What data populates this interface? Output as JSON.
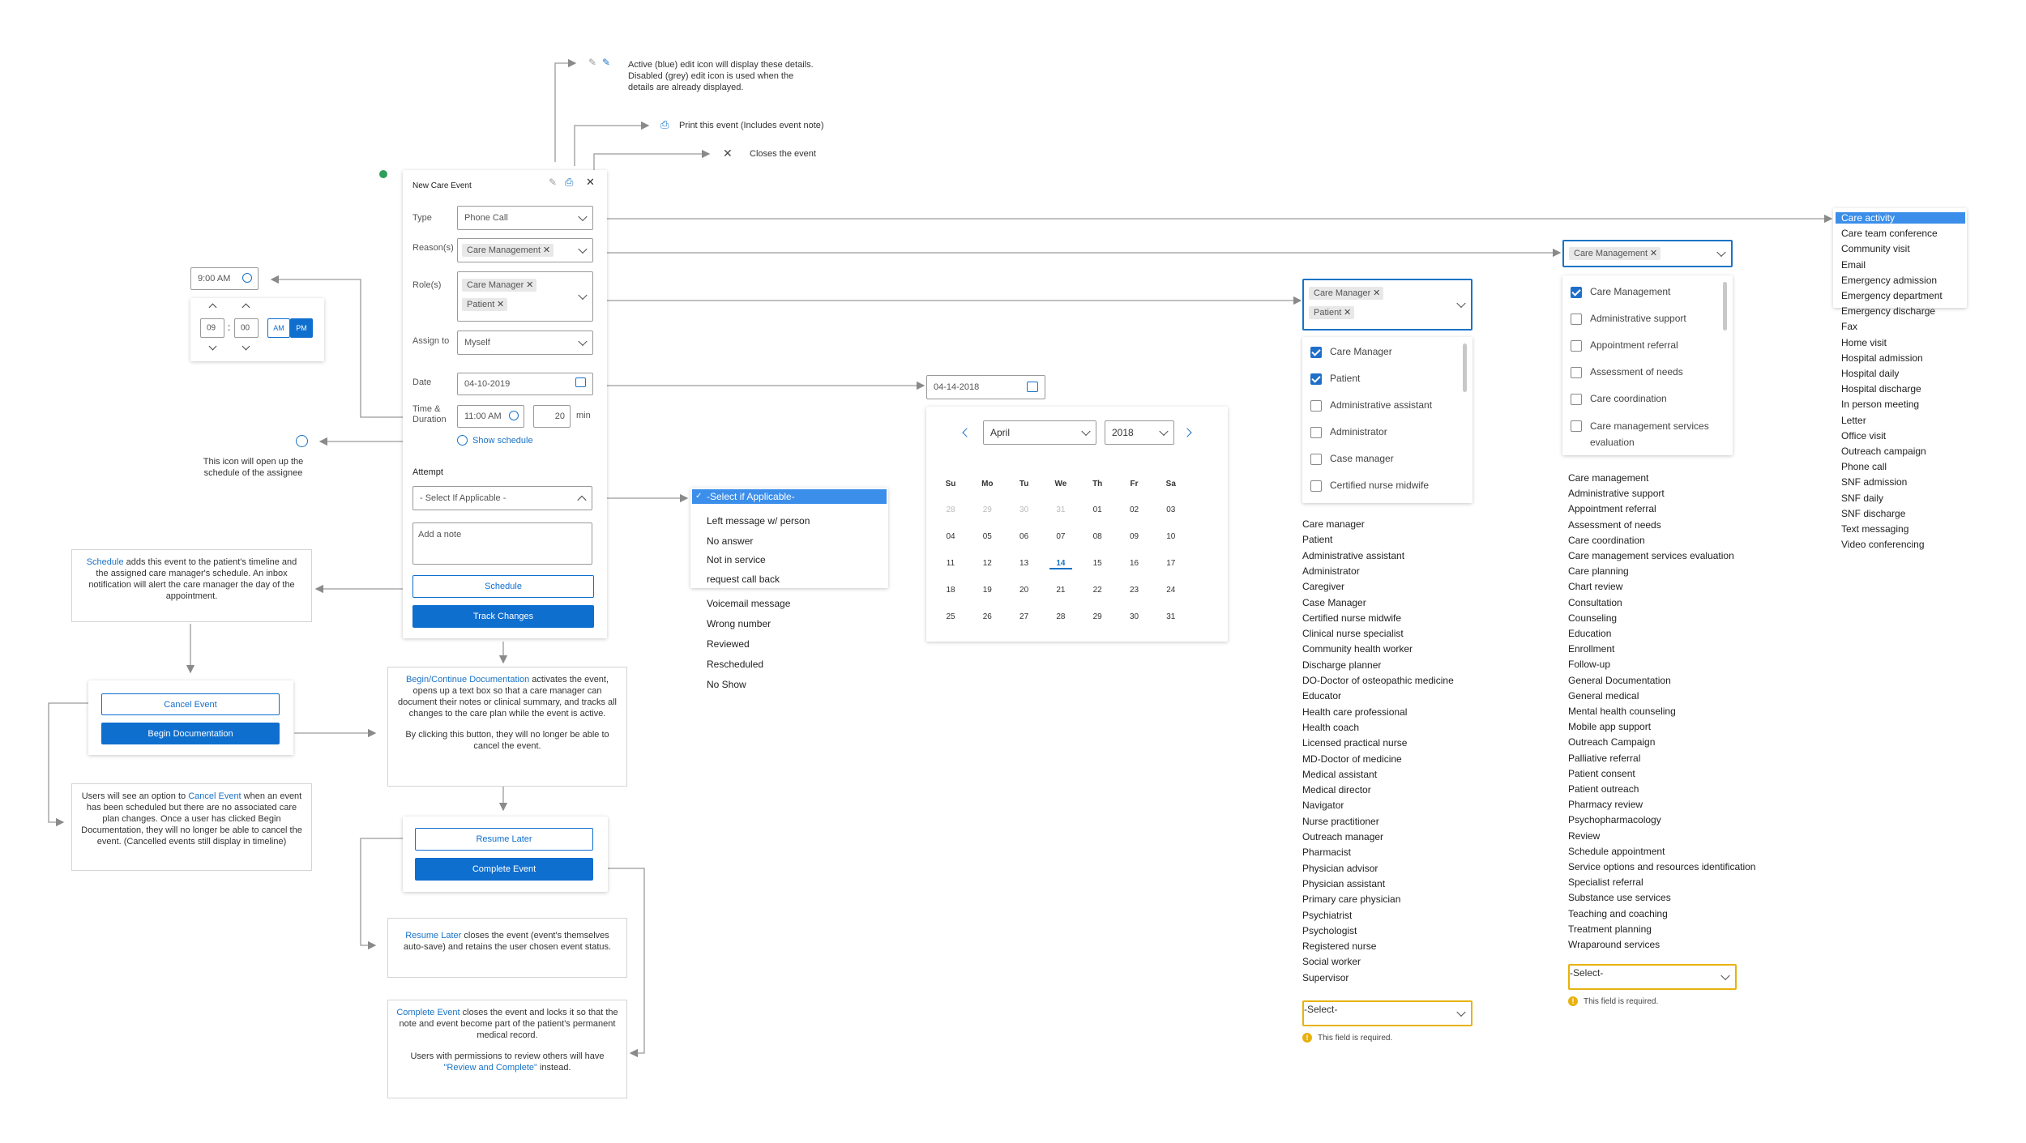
{
  "colors": {
    "accent": "#0f6fcf",
    "warning": "#e8b20e",
    "status_dot": "#2e9e5b"
  },
  "annotations": {
    "edit_line1": "Active (blue) edit icon will display these details.",
    "edit_line2": "Disabled (grey) edit icon is used when the",
    "edit_line3": "details are already displayed.",
    "print": "Print this event (Includes event note)",
    "close": "Closes the event",
    "schedule_icon_line1": "This icon will open up the",
    "schedule_icon_line2": "schedule of the assignee"
  },
  "form": {
    "title": "New Care Event",
    "type_label": "Type",
    "type_value": "Phone Call",
    "reason_label": "Reason(s)",
    "reason_chip": "Care Management",
    "role_label": "Role(s)",
    "role_chips": [
      "Care Manager",
      "Patient"
    ],
    "assign_label": "Assign to",
    "assign_value": "Myself",
    "date_label": "Date",
    "date_value": "04-10-2019",
    "time_label_1": "Time &",
    "time_label_2": "Duration",
    "time_value": "11:00 AM",
    "duration_value": "20",
    "duration_unit": "min",
    "show_schedule": "Show schedule",
    "attempt_label": "Attempt",
    "attempt_value": "- Select If Applicable -",
    "note_placeholder": "Add a note",
    "schedule_btn": "Schedule",
    "track_btn": "Track Changes"
  },
  "time_picker": {
    "field_value": "9:00 AM",
    "hour": "09",
    "minute": "00",
    "am": "AM",
    "pm": "PM"
  },
  "attempt_dropdown": {
    "selected": "-Select if Applicable-",
    "items": [
      "Left message w/ person",
      "No answer",
      "Not in service",
      "request call back"
    ],
    "overflow_items": [
      "Voicemail message",
      "Wrong number",
      "Reviewed",
      "Rescheduled",
      "No Show"
    ]
  },
  "calendar": {
    "field_value": "04-14-2018",
    "month": "April",
    "year": "2018",
    "weekdays": [
      "Su",
      "Mo",
      "Tu",
      "We",
      "Th",
      "Fr",
      "Sa"
    ],
    "weeks": [
      [
        "28",
        "29",
        "30",
        "31",
        "01",
        "02",
        "03"
      ],
      [
        "04",
        "05",
        "06",
        "07",
        "08",
        "09",
        "10"
      ],
      [
        "11",
        "12",
        "13",
        "14",
        "15",
        "16",
        "17"
      ],
      [
        "18",
        "19",
        "20",
        "21",
        "22",
        "23",
        "24"
      ],
      [
        "25",
        "26",
        "27",
        "28",
        "29",
        "30",
        "31"
      ]
    ],
    "selected": "14"
  },
  "roles_dropdown": {
    "chips": [
      "Care Manager",
      "Patient"
    ],
    "options": [
      {
        "label": "Care Manager",
        "checked": true
      },
      {
        "label": "Patient",
        "checked": true
      },
      {
        "label": "Administrative assistant",
        "checked": false
      },
      {
        "label": "Administrator",
        "checked": false
      },
      {
        "label": "Case manager",
        "checked": false
      },
      {
        "label": "Certified nurse midwife",
        "checked": false
      }
    ],
    "full_list": [
      "Care manager",
      "Patient",
      "Administrative assistant",
      "Administrator",
      "Caregiver",
      "Case Manager",
      "Certified nurse midwife",
      "Clinical nurse specialist",
      "Community health worker",
      "Discharge planner",
      "DO-Doctor of osteopathic medicine",
      "Educator",
      "Health care professional",
      "Health coach",
      "Licensed practical nurse",
      "MD-Doctor of medicine",
      "Medical assistant",
      "Medical director",
      "Navigator",
      "Nurse practitioner",
      "Outreach manager",
      "Pharmacist",
      "Physician advisor",
      "Physician assistant",
      "Primary care physician",
      "Psychiatrist",
      "Psychologist",
      "Registered nurse",
      "Social worker",
      "Supervisor"
    ],
    "select_placeholder": "-Select-",
    "required_msg": "This field is required."
  },
  "reasons_dropdown": {
    "chip": "Care Management",
    "options": [
      {
        "label": "Care Management",
        "checked": true
      },
      {
        "label": "Administrative support",
        "checked": false
      },
      {
        "label": "Appointment referral",
        "checked": false
      },
      {
        "label": "Assessment of needs",
        "checked": false
      },
      {
        "label": "Care coordination",
        "checked": false
      },
      {
        "label": "Care management services evaluation",
        "checked": false
      }
    ],
    "full_list": [
      "Care management",
      "Administrative support",
      "Appointment referral",
      "Assessment of needs",
      "Care coordination",
      "Care management services evaluation",
      "Care planning",
      "Chart review",
      "Consultation",
      "Counseling",
      "Education",
      "Enrollment",
      "Follow-up",
      "General Documentation",
      "General medical",
      "Mental health counseling",
      "Mobile app support",
      "Outreach Campaign",
      "Palliative referral",
      "Patient consent",
      "Patient outreach",
      "Pharmacy review",
      "Psychopharmacology",
      "Review",
      "Schedule appointment",
      "Service options and resources identification",
      "Specialist referral",
      "Substance use services",
      "Teaching and coaching",
      "Treatment planning",
      "Wraparound services"
    ],
    "select_placeholder": "-Select-",
    "required_msg": "This field is required."
  },
  "type_dropdown": {
    "items": [
      "Care activity",
      "Care team conference",
      "Community visit",
      "Email",
      "Emergency admission",
      "Emergency department",
      "Emergency discharge",
      "Fax",
      "Home visit",
      "Hospital admission",
      "Hospital daily",
      "Hospital discharge",
      "In person meeting",
      "Letter",
      "Office visit",
      "Outreach campaign",
      "Phone call",
      "SNF admission",
      "SNF daily",
      "SNF discharge",
      "Text messaging",
      "Video conferencing"
    ]
  },
  "notes": {
    "schedule_title": "Schedule",
    "schedule_body": " adds this event to the patient's timeline and the assigned care manager's schedule. An inbox notification will alert the care manager the day of the appointment.",
    "cancel_btn": "Cancel Event",
    "begin_btn": "Begin Documentation",
    "cancel_note_pre": "Users will see an option to ",
    "cancel_note_link": "Cancel Event",
    "cancel_note_post": " when an event has been scheduled but there are no associated care plan changes. Once a user has clicked Begin Documentation, they will no longer be able to cancel the event. (Cancelled events still display in timeline)",
    "begin_note_link": "Begin/Continue Documentation",
    "begin_note_body": " activates the event, opens up a text box so that a care manager can document their notes or clinical summary, and tracks all changes to the care plan while the event is active.",
    "begin_note_body2": "By clicking this button, they will no longer be able to cancel the event.",
    "resume_btn": "Resume Later",
    "complete_btn": "Complete Event",
    "resume_note_link": "Resume Later",
    "resume_note_body": " closes the event (event's themselves auto-save) and retains the user chosen event status.",
    "complete_note_link": "Complete Event",
    "complete_note_body": " closes the event and locks it so that the note and event become part of the patient's permanent medical record.",
    "complete_note_body2_pre": "Users with permissions to review others will have ",
    "complete_note_body2_link": "\"Review and Complete\"",
    "complete_note_body2_post": " instead."
  }
}
